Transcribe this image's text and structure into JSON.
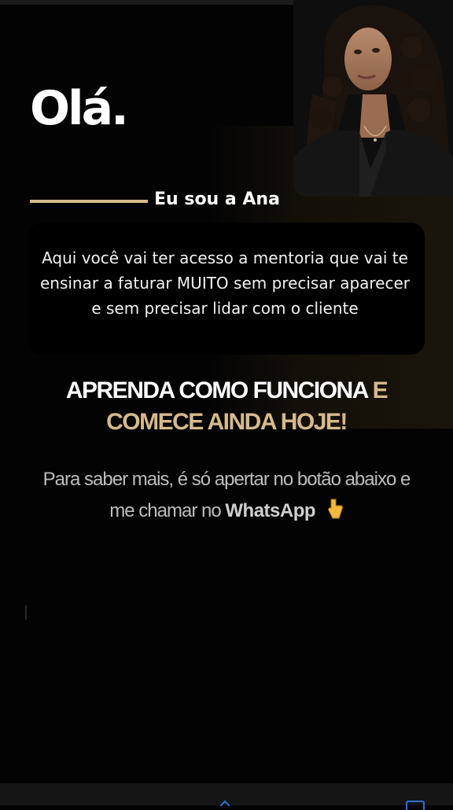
{
  "hero": {
    "greeting": "Olá.",
    "name_line": "Eu sou a Ana"
  },
  "intro": {
    "text": "Aqui você vai ter acesso a mentoria que vai te ensinar a faturar MUITO sem precisar aparecer e sem precisar lidar com o cliente"
  },
  "headline": {
    "white": "APRENDA COMO FUNCIONA",
    "gold": "E COMECE AINDA HOJE!"
  },
  "cta": {
    "text": "Para saber mais, é só apertar no botão abaixo e me chamar no",
    "whatsapp": "WhatsApp",
    "icon": "pointing-down-hand-icon"
  },
  "colors": {
    "accent_gold": "#d9b98a",
    "background": "#030303"
  }
}
